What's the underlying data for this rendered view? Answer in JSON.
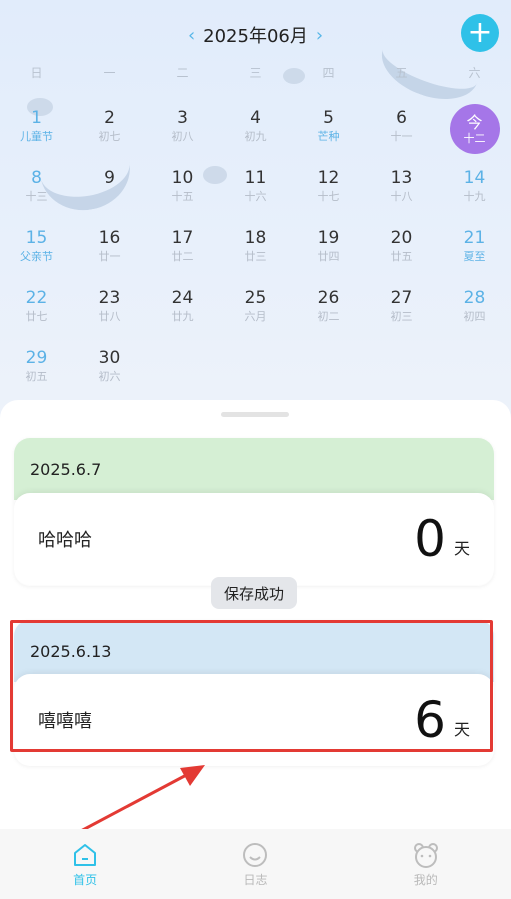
{
  "calendar": {
    "title": "2025年06月",
    "prev_arrow": "‹",
    "next_arrow": "›",
    "add_label": "+",
    "weekdays": [
      "日",
      "一",
      "二",
      "三",
      "四",
      "五",
      "六"
    ],
    "today_label": "今",
    "today_sub": "十二",
    "days": [
      {
        "num": "1",
        "sub": "儿童节"
      },
      {
        "num": "2",
        "sub": "初七"
      },
      {
        "num": "3",
        "sub": "初八"
      },
      {
        "num": "4",
        "sub": "初九"
      },
      {
        "num": "5",
        "sub": "芒种"
      },
      {
        "num": "6",
        "sub": "十一"
      },
      {
        "num": "",
        "sub": ""
      },
      {
        "num": "8",
        "sub": "十三"
      },
      {
        "num": "9",
        "sub": ""
      },
      {
        "num": "10",
        "sub": "十五"
      },
      {
        "num": "11",
        "sub": "十六"
      },
      {
        "num": "12",
        "sub": "十七"
      },
      {
        "num": "13",
        "sub": "十八"
      },
      {
        "num": "14",
        "sub": "十九"
      },
      {
        "num": "15",
        "sub": "父亲节"
      },
      {
        "num": "16",
        "sub": "廿一"
      },
      {
        "num": "17",
        "sub": "廿二"
      },
      {
        "num": "18",
        "sub": "廿三"
      },
      {
        "num": "19",
        "sub": "廿四"
      },
      {
        "num": "20",
        "sub": "廿五"
      },
      {
        "num": "21",
        "sub": "夏至"
      },
      {
        "num": "22",
        "sub": "廿七"
      },
      {
        "num": "23",
        "sub": "廿八"
      },
      {
        "num": "24",
        "sub": "廿九"
      },
      {
        "num": "25",
        "sub": "六月"
      },
      {
        "num": "26",
        "sub": "初二"
      },
      {
        "num": "27",
        "sub": "初三"
      },
      {
        "num": "28",
        "sub": "初四"
      },
      {
        "num": "29",
        "sub": "初五"
      },
      {
        "num": "30",
        "sub": "初六"
      }
    ]
  },
  "cards": [
    {
      "date": "2025.6.7",
      "title": "哈哈哈",
      "days": "0",
      "unit": "天",
      "header_color": "#d5efd4"
    },
    {
      "date": "2025.6.13",
      "title": "嘻嘻嘻",
      "days": "6",
      "unit": "天",
      "header_color": "#d3e7f5"
    }
  ],
  "toast": "保存成功",
  "tabs": [
    {
      "label": "首页",
      "icon": "home-icon",
      "active": true
    },
    {
      "label": "日志",
      "icon": "smile-icon",
      "active": false
    },
    {
      "label": "我的",
      "icon": "bear-icon",
      "active": false
    }
  ],
  "colors": {
    "accent": "#2fc1e8",
    "today": "#a576e8",
    "highlight": "#e33a34"
  }
}
